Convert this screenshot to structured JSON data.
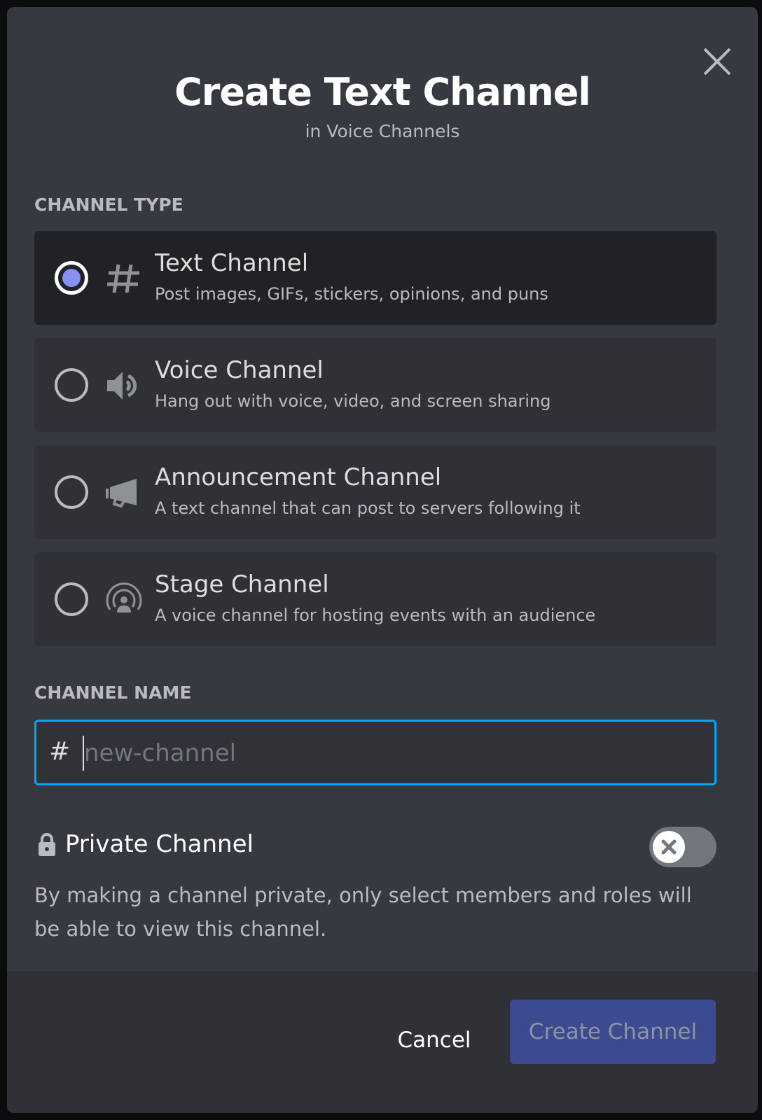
{
  "modal": {
    "title": "Create Text Channel",
    "subtitle": "in Voice Channels",
    "close_icon": "close-icon"
  },
  "channel_type": {
    "label": "CHANNEL TYPE",
    "selected": "text",
    "options": [
      {
        "id": "text",
        "icon": "hash-icon",
        "title": "Text Channel",
        "description": "Post images, GIFs, stickers, opinions, and puns",
        "selected": true
      },
      {
        "id": "voice",
        "icon": "speaker-icon",
        "title": "Voice Channel",
        "description": "Hang out with voice, video, and screen sharing",
        "selected": false
      },
      {
        "id": "announcement",
        "icon": "megaphone-icon",
        "title": "Announcement Channel",
        "description": "A text channel that can post to servers following it",
        "selected": false
      },
      {
        "id": "stage",
        "icon": "stage-icon",
        "title": "Stage Channel",
        "description": "A voice channel for hosting events with an audience",
        "selected": false
      }
    ]
  },
  "channel_name": {
    "label": "CHANNEL NAME",
    "prefix": "#",
    "value": "",
    "placeholder": "new-channel"
  },
  "private": {
    "label": "Private Channel",
    "enabled": false,
    "description": "By making a channel private, only select members and roles will be able to view this channel."
  },
  "footer": {
    "cancel_label": "Cancel",
    "create_label": "Create Channel"
  },
  "colors": {
    "modal_bg": "#36393f",
    "selected_option_bg": "#202225",
    "option_bg": "#2f3136",
    "radio_selected": "#8891f2",
    "input_focus_border": "#00a8fc",
    "primary_button_disabled": "#3c4a8f"
  }
}
